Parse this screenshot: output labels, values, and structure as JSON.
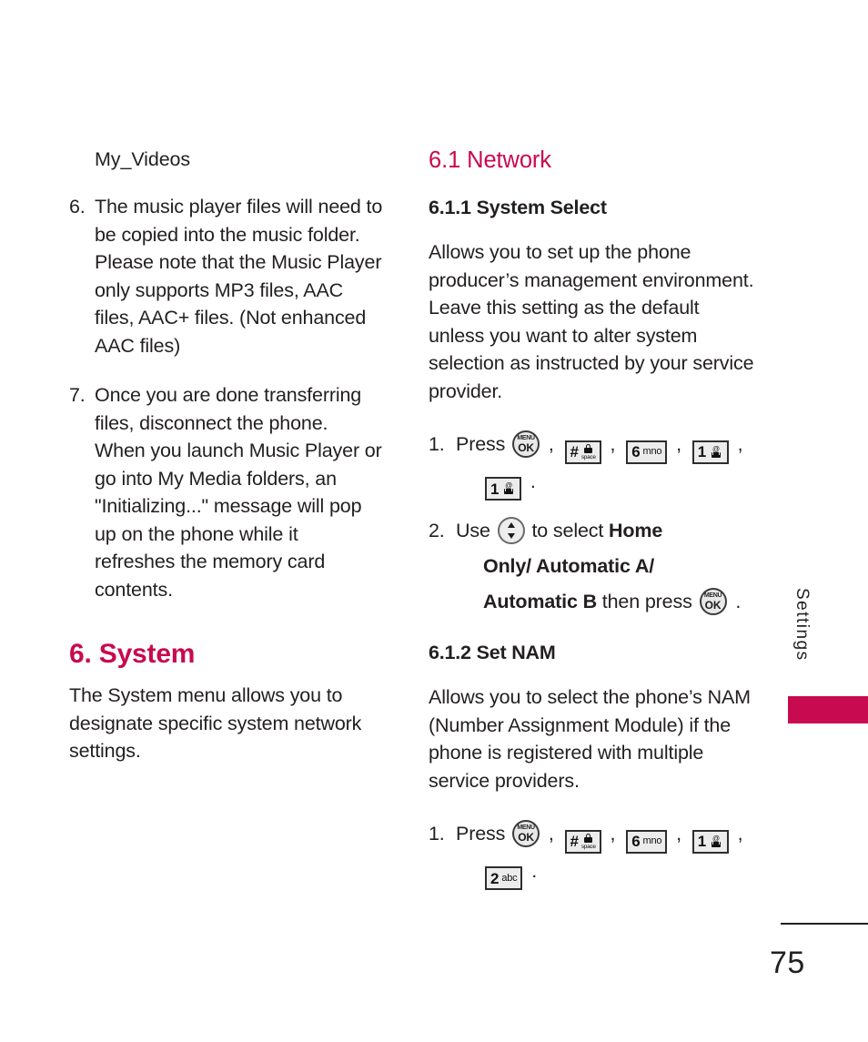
{
  "accent_color": "#c80a50",
  "text_color": "#231f20",
  "left_column": {
    "subfolder_label": "My_Videos",
    "list_items": [
      {
        "num": "6.",
        "text": "The music player files will need to be copied into the music folder. Please note that the Music Player only supports MP3 files, AAC files, AAC+ files. (Not enhanced AAC files)"
      },
      {
        "num": "7.",
        "text": "Once you are done transferring files, disconnect the phone. When you launch Music Player or go into My Media folders, an \"Initializing...\" message will pop up on the phone while it refreshes the memory card contents."
      }
    ],
    "section_heading": "6. System",
    "section_body": "The System menu allows you to designate specific system network settings."
  },
  "right_column": {
    "heading": "6.1 Network",
    "subsection_1": {
      "heading": "6.1.1 System Select",
      "body": "Allows you to set up the phone producer’s management environment. Leave this setting as the default unless you want to alter system selection as instructed by your service provider.",
      "step_1": {
        "num": "1.",
        "verb": "Press",
        "keys": [
          "menu-ok",
          "hash-space",
          "six-mno",
          "one-voicemail",
          "one-voicemail"
        ],
        "terminator": "."
      },
      "step_2": {
        "num": "2.",
        "lead": "Use",
        "middle": "to select",
        "options_line1": "Home",
        "options_line2": "Only/ Automatic A/",
        "options_line3": "Automatic B",
        "tail": "then press",
        "terminator": "."
      }
    },
    "subsection_2": {
      "heading": "6.1.2 Set NAM",
      "body": "Allows you to select the phone’s NAM (Number Assignment Module) if the phone is registered with multiple service providers.",
      "step_1": {
        "num": "1.",
        "verb": "Press",
        "keys": [
          "menu-ok",
          "hash-space",
          "six-mno",
          "one-voicemail",
          "two-abc"
        ],
        "terminator": "."
      }
    }
  },
  "keys": {
    "menu_ok": {
      "top": "MENU",
      "bottom": "OK"
    },
    "hash_space": {
      "big": "#",
      "small": "space",
      "icon": "lock-icon"
    },
    "six_mno": {
      "big": "6",
      "small": "mno"
    },
    "one_voicemail": {
      "big": "1",
      "icon": "voicemail-icon"
    },
    "two_abc": {
      "big": "2",
      "small": "abc"
    }
  },
  "side_tab": {
    "label": "Settings"
  },
  "footer": {
    "page_number": "75"
  },
  "punctuation": {
    "comma": ",",
    "period": "."
  }
}
